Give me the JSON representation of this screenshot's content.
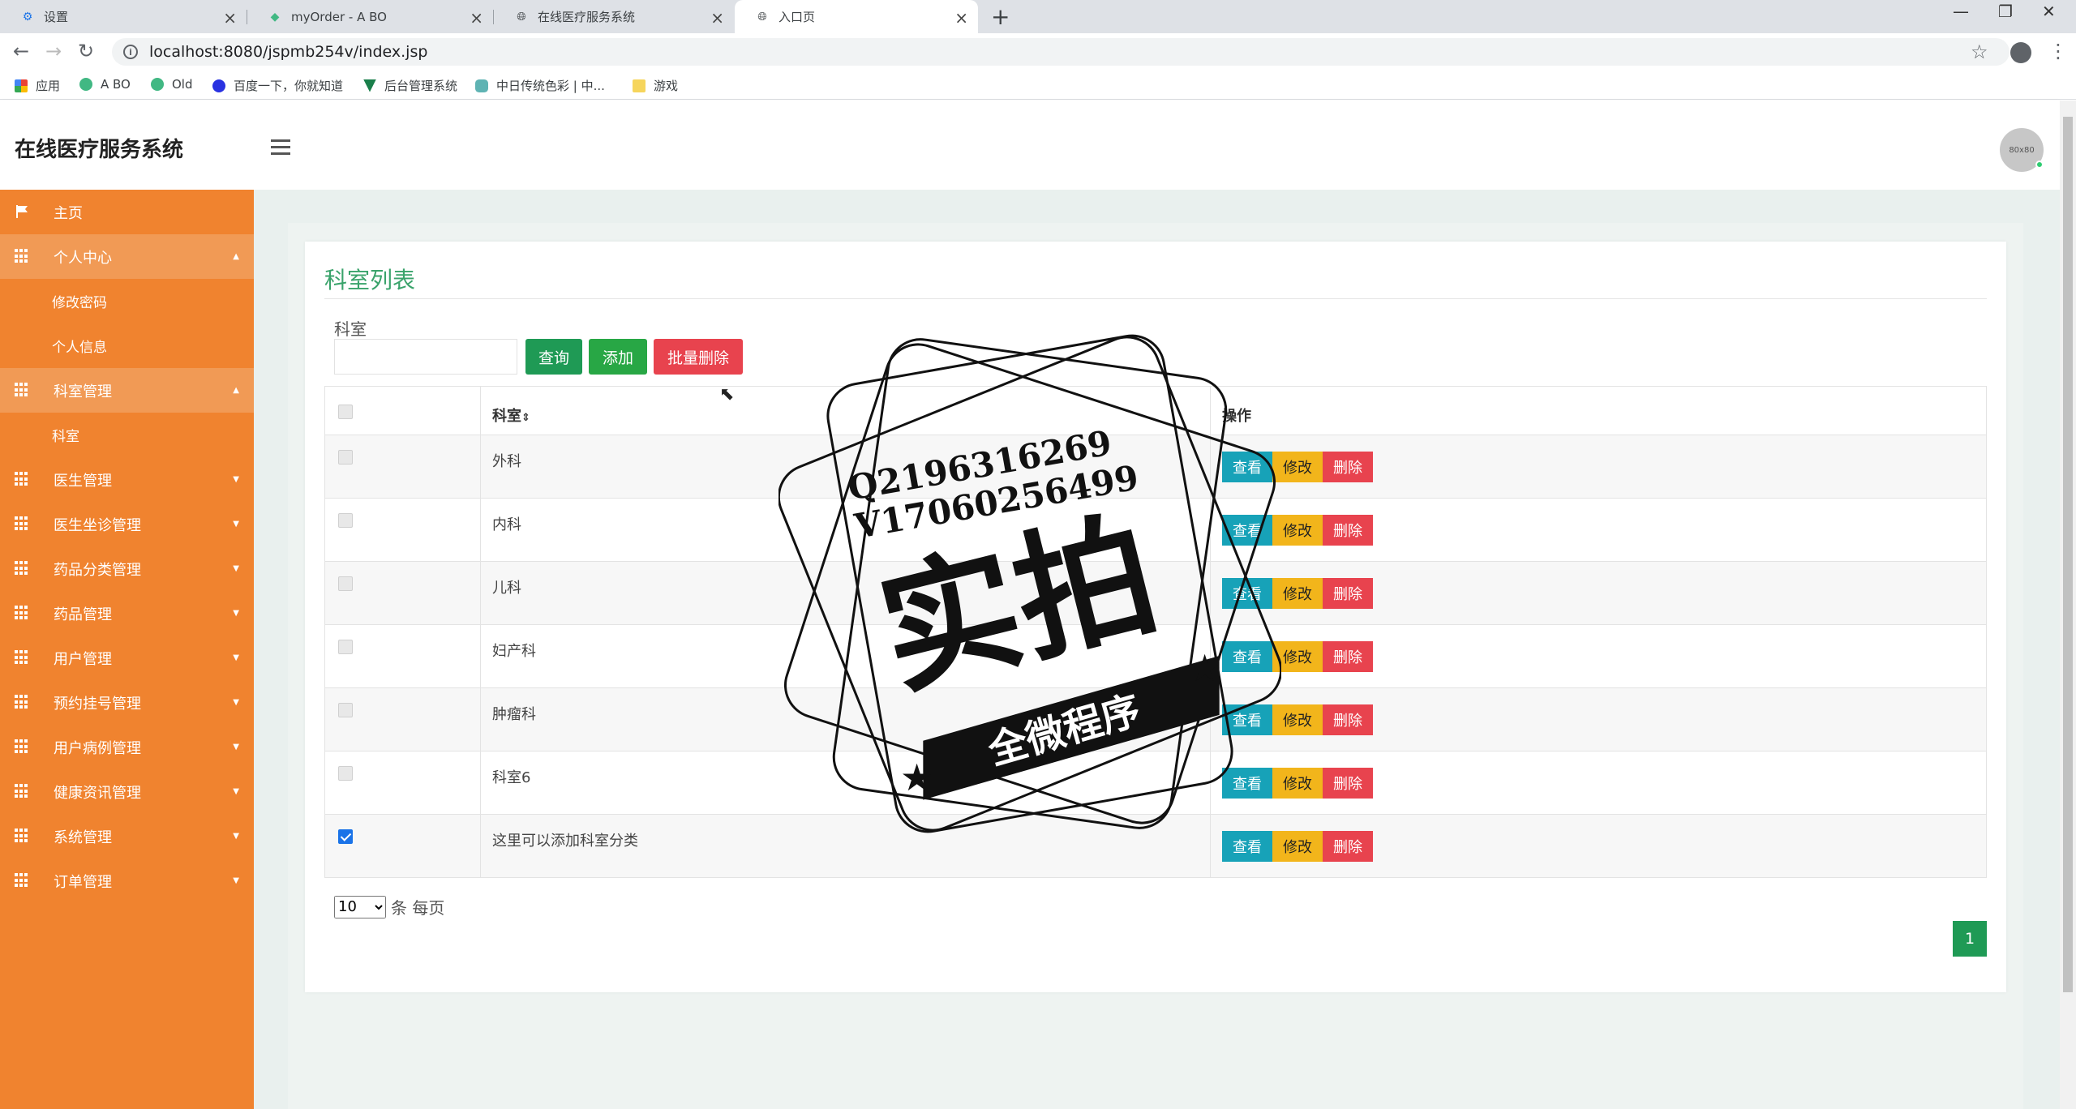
{
  "browser": {
    "tabs": [
      {
        "title": "设置",
        "icon": "gear-icon"
      },
      {
        "title": "myOrder - A BO",
        "icon": "vue-logo-icon"
      },
      {
        "title": "在线医疗服务系统",
        "icon": "globe-icon"
      },
      {
        "title": "入口页",
        "icon": "globe-icon",
        "active": true
      }
    ],
    "url": "localhost:8080/jspmb254v/index.jsp",
    "bookmarks": [
      {
        "label": "应用",
        "icon": "apps-grid-icon"
      },
      {
        "label": "A BO",
        "icon": "vue-logo-icon"
      },
      {
        "label": "Old",
        "icon": "vue-logo-icon"
      },
      {
        "label": "百度一下，你就知道",
        "icon": "baidu-paw-icon"
      },
      {
        "label": "后台管理系统",
        "icon": "vue-logo-icon"
      },
      {
        "label": "中日传统色彩 | 中...",
        "icon": "flower-icon"
      },
      {
        "label": "游戏",
        "icon": "folder-icon"
      }
    ]
  },
  "app": {
    "title": "在线医疗服务系统",
    "avatar_text": "80x80"
  },
  "sidebar": {
    "items": [
      {
        "label": "主页",
        "icon": "flag-icon"
      },
      {
        "label": "个人中心",
        "icon": "grid-icon",
        "open": true,
        "children": [
          "修改密码",
          "个人信息"
        ]
      },
      {
        "label": "科室管理",
        "icon": "grid-icon",
        "open": true,
        "children": [
          "科室"
        ]
      },
      {
        "label": "医生管理",
        "icon": "grid-icon"
      },
      {
        "label": "医生坐诊管理",
        "icon": "grid-icon"
      },
      {
        "label": "药品分类管理",
        "icon": "grid-icon"
      },
      {
        "label": "药品管理",
        "icon": "grid-icon"
      },
      {
        "label": "用户管理",
        "icon": "grid-icon"
      },
      {
        "label": "预约挂号管理",
        "icon": "grid-icon"
      },
      {
        "label": "用户病例管理",
        "icon": "grid-icon"
      },
      {
        "label": "健康资讯管理",
        "icon": "grid-icon"
      },
      {
        "label": "系统管理",
        "icon": "grid-icon"
      },
      {
        "label": "订单管理",
        "icon": "grid-icon"
      }
    ]
  },
  "main": {
    "title": "科室列表",
    "search_label": "科室",
    "search_value": "",
    "buttons": {
      "query": "查询",
      "add": "添加",
      "batch_delete": "批量删除"
    },
    "table": {
      "headers": [
        "",
        "科室",
        "操作"
      ],
      "sort_icon": "sort-icon",
      "rows": [
        {
          "name": "外科",
          "checked": false
        },
        {
          "name": "内科",
          "checked": false
        },
        {
          "name": "儿科",
          "checked": false
        },
        {
          "name": "妇产科",
          "checked": false
        },
        {
          "name": "肿瘤科",
          "checked": false
        },
        {
          "name": "科室6",
          "checked": false
        },
        {
          "name": "这里可以添加科室分类",
          "checked": true
        }
      ],
      "row_actions": {
        "view": "查看",
        "edit": "修改",
        "delete": "删除"
      }
    },
    "pagination": {
      "page_size": "10",
      "page_size_suffix": "条 每页",
      "current_page": "1"
    }
  },
  "watermark": {
    "line1": "Q2196316269",
    "line2": "V17060256499",
    "big_text": "实拍",
    "banner": "全微程序"
  }
}
